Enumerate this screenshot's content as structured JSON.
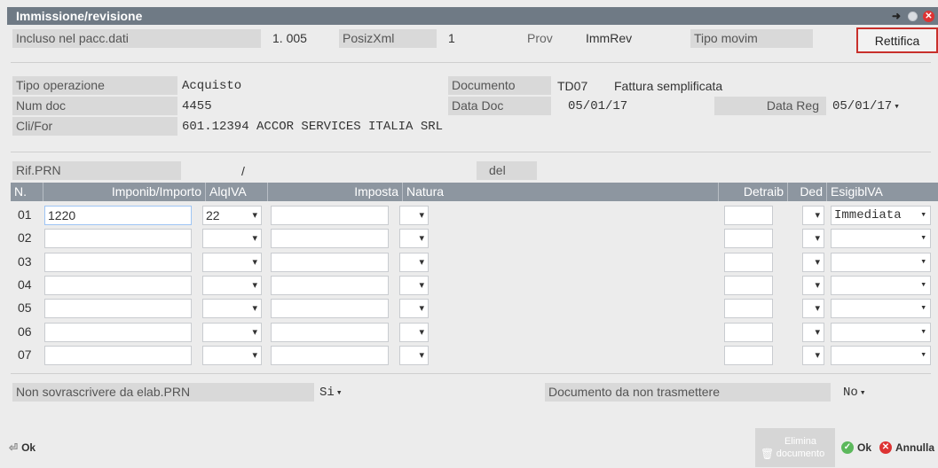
{
  "window": {
    "title": "Immissione/revisione"
  },
  "header": {
    "incluso_label": "Incluso nel pacc.dati",
    "incluso_value": "1. 005",
    "posizxml_label": "PosizXml",
    "posizxml_value": "1",
    "prov_label": "Prov",
    "prov_value": "ImmRev",
    "tipo_movim_label": "Tipo movim",
    "rettifica_label": "Rettifica"
  },
  "doc": {
    "tipo_operazione_label": "Tipo operazione",
    "tipo_operazione_value": "Acquisto",
    "num_doc_label": "Num doc",
    "num_doc_value": "4455",
    "clifor_label": "Cli/For",
    "clifor_value": "601.12394 ACCOR SERVICES ITALIA SRL",
    "documento_label": "Documento",
    "documento_code": "TD07",
    "documento_desc": "Fattura semplificata",
    "data_doc_label": "Data Doc",
    "data_doc_value": "05/01/17",
    "data_reg_label": "Data Reg",
    "data_reg_value": "05/01/17"
  },
  "rif": {
    "rif_prn_label": "Rif.PRN",
    "slash": "/",
    "del_label": "del"
  },
  "grid": {
    "headers": {
      "n": "N.",
      "imponib": "Imponib/Importo",
      "alqiva": "AlqIVA",
      "imposta": "Imposta",
      "natura": "Natura",
      "detraib": "Detraib",
      "ded": "Ded",
      "esigib": "EsigiblVA"
    },
    "rows": [
      {
        "n": "01",
        "imponib": "1220",
        "alqiva": "22",
        "esigib": "Immediata"
      },
      {
        "n": "02",
        "imponib": "",
        "alqiva": "",
        "esigib": ""
      },
      {
        "n": "03",
        "imponib": "",
        "alqiva": "",
        "esigib": ""
      },
      {
        "n": "04",
        "imponib": "",
        "alqiva": "",
        "esigib": ""
      },
      {
        "n": "05",
        "imponib": "",
        "alqiva": "",
        "esigib": ""
      },
      {
        "n": "06",
        "imponib": "",
        "alqiva": "",
        "esigib": ""
      },
      {
        "n": "07",
        "imponib": "",
        "alqiva": "",
        "esigib": ""
      }
    ]
  },
  "footer": {
    "non_sovrascrivere_label": "Non sovrascrivere da elab.PRN",
    "non_sovrascrivere_value": "Si",
    "documento_non_trasm_label": "Documento da non trasmettere",
    "documento_non_trasm_value": "No"
  },
  "buttons": {
    "ok_left": "Ok",
    "elimina": "Elimina documento",
    "ok": "Ok",
    "annulla": "Annulla"
  },
  "icons": {
    "pin": "pin-icon",
    "minimize": "circle-icon",
    "close": "close-icon",
    "enter": "enter-icon",
    "check": "check-icon",
    "cancel": "x-icon",
    "trash": "trash-icon"
  }
}
